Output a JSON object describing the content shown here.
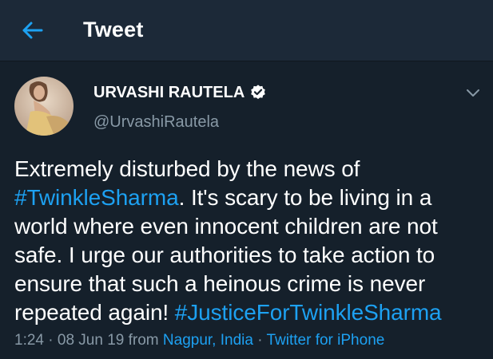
{
  "header": {
    "title": "Tweet",
    "back_icon": "arrow-left-icon",
    "accent": "#1da1f2"
  },
  "author": {
    "name": "URVASHI RAUTELA",
    "handle": "@UrvashiRautela",
    "verified_icon": "verified-badge-icon"
  },
  "menu": {
    "icon": "chevron-down-icon"
  },
  "tweet": {
    "text_1": "Extremely disturbed by the news of ",
    "hashtag_1": "#TwinkleSharma",
    "text_2": ". It's scary to be living in a world where even innocent children are not safe. I urge our authorities to take action to ensure that such a heinous crime is never repeated again! ",
    "hashtag_2": "#JusticeForTwinkleSharma"
  },
  "meta": {
    "time": "1:24",
    "sep_1": " · ",
    "date": "08 Jun 19",
    "from": " from ",
    "location": "Nagpur, India",
    "sep_2": " · ",
    "source": "Twitter for iPhone"
  },
  "colors": {
    "background": "#15202b",
    "header_bg": "#1c2938",
    "secondary_text": "#8899a6",
    "link": "#1da1f2"
  }
}
